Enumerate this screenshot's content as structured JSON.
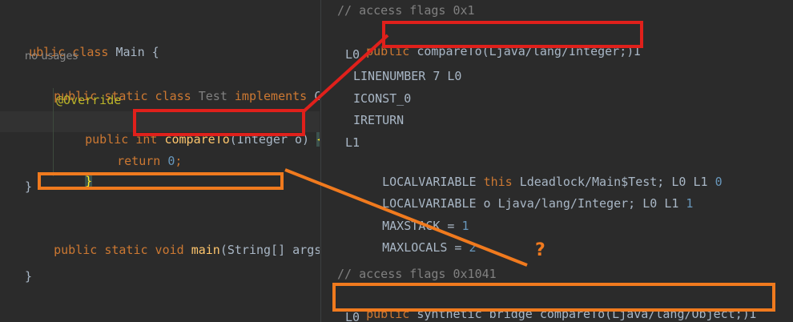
{
  "left_editor": {
    "line1": {
      "kw": "ublic class ",
      "name": "Main",
      "brace": " {"
    },
    "usages_hint": "no usages",
    "line3": {
      "kw": "public static class ",
      "name": "Test",
      "impl": " implements ",
      "tail": "C"
    },
    "annotation": "@Override",
    "line5": {
      "kw": "public int ",
      "method": "compareTo",
      "paren": "(Integer o) ",
      "brace": "{"
    },
    "line6": {
      "kw": "return ",
      "num": "0",
      "semi": ";"
    },
    "line7": "}",
    "line8": "}",
    "line9": {
      "kw": "public static void ",
      "method": "main",
      "args": "(String[] args"
    },
    "line10": "}"
  },
  "right_bytecode": {
    "comment1": "// access flags 0x1",
    "sig1": {
      "kw": "public",
      "rest": " compareTo(Ljava/lang/Integer;)I"
    },
    "l0": "L0",
    "linenumber": "LINENUMBER 7 L0",
    "iconst": "ICONST_0",
    "ireturn": "IRETURN",
    "l1": "L1",
    "localvar1": {
      "prefix": "LOCALVARIABLE ",
      "kw": "this",
      "rest": " Ldeadlock/Main$Test; L0 L1 ",
      "num": "0"
    },
    "localvar2": {
      "prefix": "LOCALVARIABLE o Ljava/lang/Integer; L0 L1 ",
      "num": "1"
    },
    "maxstack": {
      "prefix": "MAXSTACK = ",
      "num": "1"
    },
    "maxlocals": {
      "prefix": "MAXLOCALS = ",
      "num": "2"
    },
    "comment2": "// access flags 0x1041",
    "sig2": {
      "kw": "public",
      "rest": " synthetic bridge compareTo(Ljava/lang/Object;)I"
    },
    "l0_bottom": "L0"
  },
  "annotations": {
    "question_mark": "?",
    "colors": {
      "red": "#e0201b",
      "orange": "#f07a1e"
    }
  }
}
